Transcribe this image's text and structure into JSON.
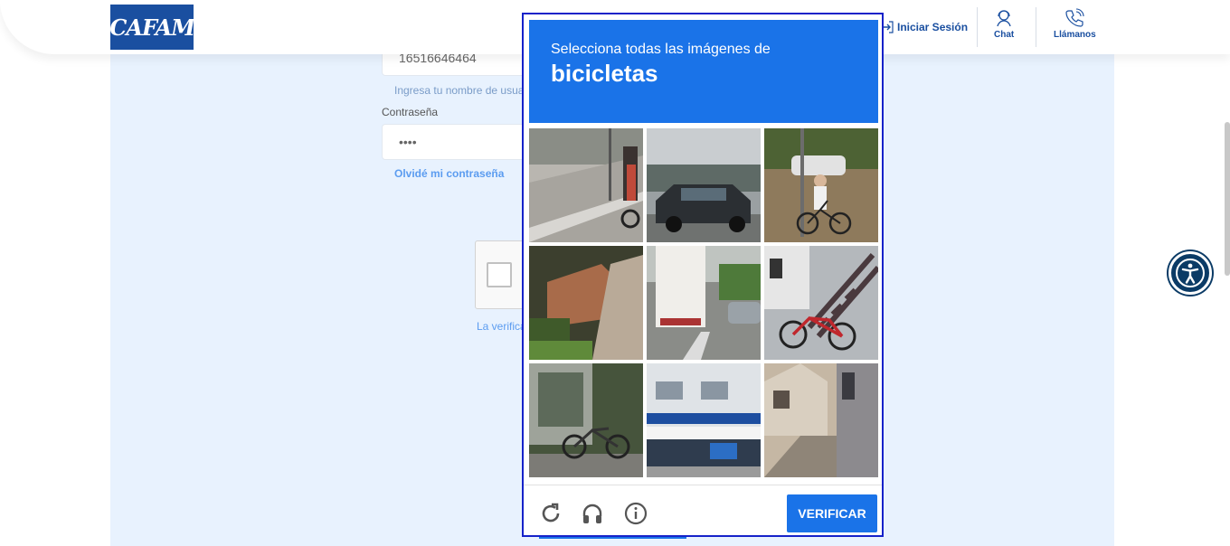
{
  "header": {
    "logo_text": "CAFAM",
    "login_label": "Iniciar Sesión",
    "chat_label": "Chat",
    "call_label": "Llámanos"
  },
  "form": {
    "id_value": "16516646464",
    "id_hint": "Ingresa tu nombre de usua",
    "password_label": "Contraseña",
    "password_value": "••••",
    "forgot_label": "Olvidé mi contraseña",
    "verification_text": "La verifica"
  },
  "captcha": {
    "instruction": "Selecciona todas las imágenes de",
    "target": "bicicletas",
    "verify_label": "VERIFICAR",
    "tiles": [
      {
        "icon": "street-corner-cyclist"
      },
      {
        "icon": "parked-car"
      },
      {
        "icon": "cyclist-sidewalk"
      },
      {
        "icon": "brick-wall-sidewalk"
      },
      {
        "icon": "truck-street"
      },
      {
        "icon": "red-bicycle-stairs"
      },
      {
        "icon": "bicycle-garden"
      },
      {
        "icon": "shop-front"
      },
      {
        "icon": "houses-alley"
      }
    ]
  },
  "colors": {
    "brand": "#1a4fa0",
    "captcha_blue": "#1a73e8",
    "page_bg": "#e8f2fe"
  }
}
